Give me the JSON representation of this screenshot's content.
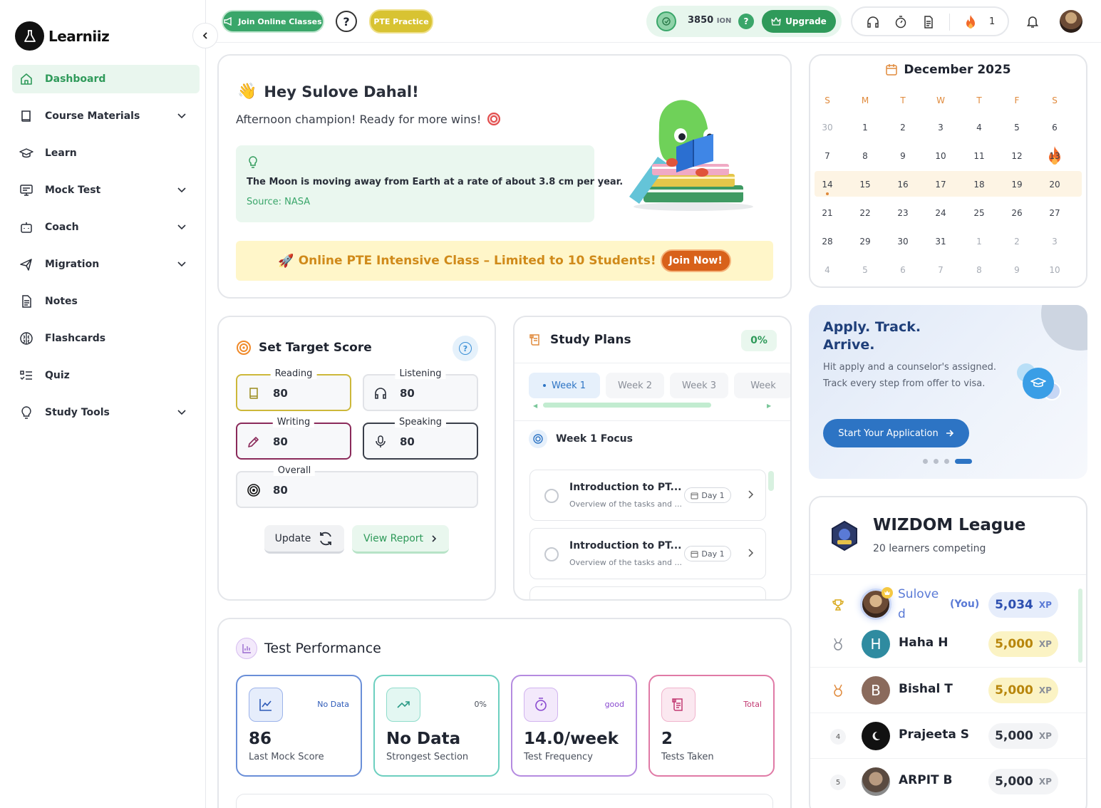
{
  "app": {
    "name": "Learniiz"
  },
  "sidebar": {
    "items": [
      {
        "label": "Dashboard",
        "icon": "home-icon",
        "active": true,
        "expandable": false
      },
      {
        "label": "Course Materials",
        "icon": "book-icon",
        "active": false,
        "expandable": true
      },
      {
        "label": "Learn",
        "icon": "graduation-cap-icon",
        "active": false,
        "expandable": false
      },
      {
        "label": "Mock Test",
        "icon": "monitor-icon",
        "active": false,
        "expandable": true
      },
      {
        "label": "Coach",
        "icon": "bot-icon",
        "active": false,
        "expandable": true
      },
      {
        "label": "Migration",
        "icon": "plane-icon",
        "active": false,
        "expandable": true
      },
      {
        "label": "Notes",
        "icon": "note-icon",
        "active": false,
        "expandable": false
      },
      {
        "label": "Flashcards",
        "icon": "brain-icon",
        "active": false,
        "expandable": false
      },
      {
        "label": "Quiz",
        "icon": "list-check-icon",
        "active": false,
        "expandable": false
      },
      {
        "label": "Study Tools",
        "icon": "lightbulb-icon",
        "active": false,
        "expandable": true
      }
    ]
  },
  "topbar": {
    "join_classes": "Join Online Classes",
    "pte_practice": "PTE Practice",
    "ion_balance": "3850",
    "ion_unit": "ION",
    "upgrade": "Upgrade",
    "streak_count": "1"
  },
  "greeting": {
    "title": "Hey Sulove Dahal!",
    "subtitle": "Afternoon champion! Ready for more wins!",
    "fact": "The Moon is moving away from Earth at a rate of about 3.8 cm per year.",
    "fact_source": "Source: NASA",
    "promo_text": "Online PTE Intensive Class – Limited to 10 Students!",
    "promo_button": "Join Now!"
  },
  "calendar": {
    "title": "December 2025",
    "weekdays": [
      "S",
      "M",
      "T",
      "W",
      "T",
      "F",
      "S"
    ],
    "weeks": [
      [
        "30",
        "1",
        "2",
        "3",
        "4",
        "5",
        "6"
      ],
      [
        "7",
        "8",
        "9",
        "10",
        "11",
        "12",
        "13"
      ],
      [
        "14",
        "15",
        "16",
        "17",
        "18",
        "19",
        "20"
      ],
      [
        "21",
        "22",
        "23",
        "24",
        "25",
        "26",
        "27"
      ],
      [
        "28",
        "29",
        "30",
        "31",
        "1",
        "2",
        "3"
      ],
      [
        "4",
        "5",
        "6",
        "7",
        "8",
        "9",
        "10"
      ]
    ],
    "streak_day": "13",
    "today": "14",
    "current_week_index": 2
  },
  "target": {
    "title": "Set Target Score",
    "reading_label": "Reading",
    "reading": "80",
    "listening_label": "Listening",
    "listening": "80",
    "writing_label": "Writing",
    "writing": "80",
    "speaking_label": "Speaking",
    "speaking": "80",
    "overall_label": "Overall",
    "overall": "80",
    "update": "Update",
    "view_report": "View Report"
  },
  "study_plans": {
    "title": "Study Plans",
    "progress": "0%",
    "weeks": [
      "Week 1",
      "Week 2",
      "Week 3",
      "Week"
    ],
    "focus": "Week 1 Focus",
    "tasks": [
      {
        "title": "Introduction to PT...",
        "subtitle": "Overview of the tasks and ...",
        "day": "Day 1"
      },
      {
        "title": "Introduction to PT...",
        "subtitle": "Overview of the tasks and ...",
        "day": "Day 1"
      }
    ]
  },
  "migration_promo": {
    "title_line1": "Apply. Track.",
    "title_line2": "Arrive.",
    "body_line1": "Hit apply and a counselor's assigned.",
    "body_line2": "Track every step from offer to visa.",
    "button": "Start Your Application"
  },
  "league": {
    "title": "WIZDOM League",
    "subtitle": "20 learners competing",
    "you_tag": "(You)",
    "xp_unit": "XP",
    "rows": [
      {
        "rank": "1",
        "name_line1": "Sulove",
        "name_line2": "d",
        "initial": "",
        "xp": "5,034",
        "self": true
      },
      {
        "rank": "2",
        "name": "Haha H",
        "initial": "H",
        "xp": "5,000"
      },
      {
        "rank": "3",
        "name": "Bishal T",
        "initial": "B",
        "xp": "5,000"
      },
      {
        "rank": "4",
        "name": "Prajeeta S",
        "initial": "",
        "xp": "5,000"
      },
      {
        "rank": "5",
        "name": "ARPIT B",
        "initial": "",
        "xp": "5,000"
      }
    ]
  },
  "performance": {
    "title": "Test Performance",
    "cards": [
      {
        "tag": "No Data",
        "value": "86",
        "label": "Last Mock Score",
        "color": "#6a8fd8"
      },
      {
        "tag": "0%",
        "value": "No Data",
        "label": "Strongest Section",
        "color": "#6ccfbf"
      },
      {
        "tag": "good",
        "value": "14.0/week",
        "label": "Test Frequency",
        "color": "#b58be0"
      },
      {
        "tag": "Total",
        "value": "2",
        "label": "Tests Taken",
        "color": "#e07aa6"
      }
    ]
  },
  "colors": {
    "brand_green": "#2f9a5a",
    "accent_yellow": "#d9c43a",
    "promo_orange": "#d86a1c",
    "link_blue": "#2d74c4"
  }
}
